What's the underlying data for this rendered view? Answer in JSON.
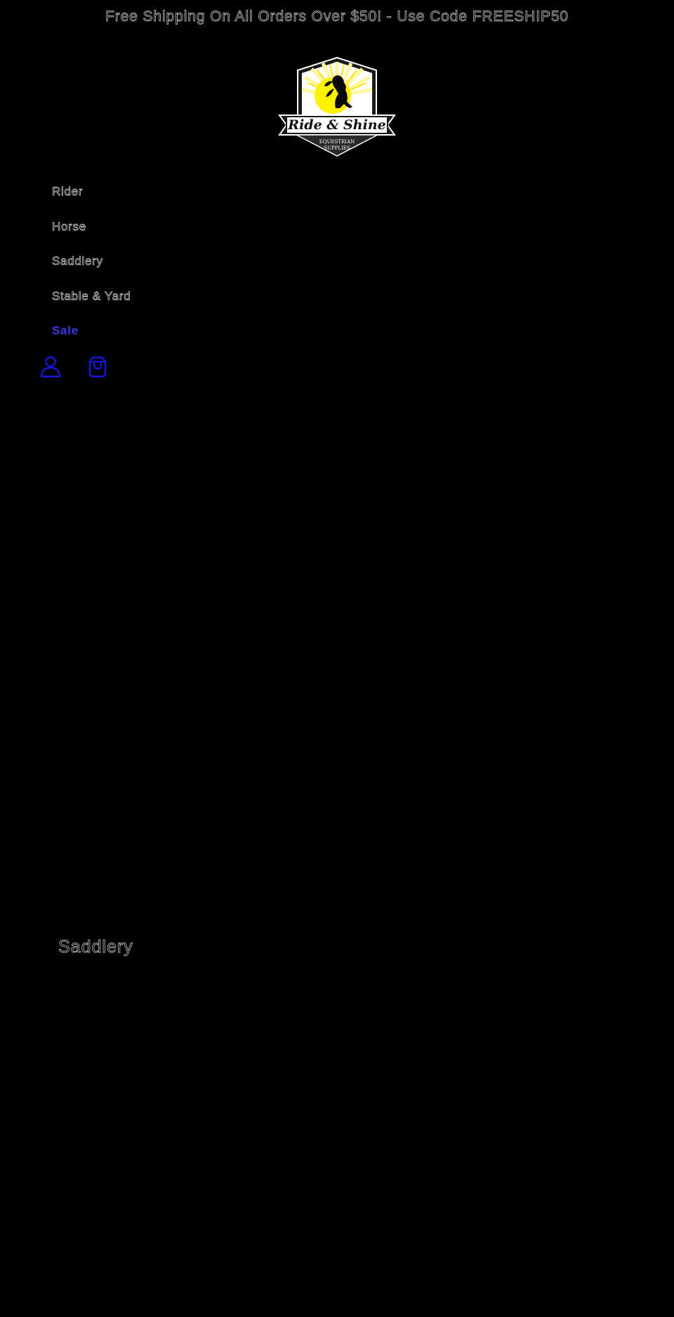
{
  "announcement": {
    "text": "Free Shipping On All Orders Over $50! - Use Code FREESHIP50"
  },
  "logo": {
    "icon": "ride-and-shine-logo",
    "title_text": "Ride & Shine",
    "subtitle_line1": "EQUESTRIAN",
    "subtitle_line2": "SUPPLIES",
    "sun_color": "#fff200",
    "ray_color": "#fff7a0"
  },
  "nav": {
    "items": [
      {
        "label": "Rider"
      },
      {
        "label": "Horse"
      },
      {
        "label": "Saddlery"
      },
      {
        "label": "Stable & Yard"
      },
      {
        "label": "Sale"
      }
    ],
    "active_color": "#3b38e6"
  },
  "header_icons": {
    "account": "account-icon",
    "cart": "cart-icon",
    "color": "#1616d8"
  },
  "section": {
    "heading": "Saddlery"
  }
}
